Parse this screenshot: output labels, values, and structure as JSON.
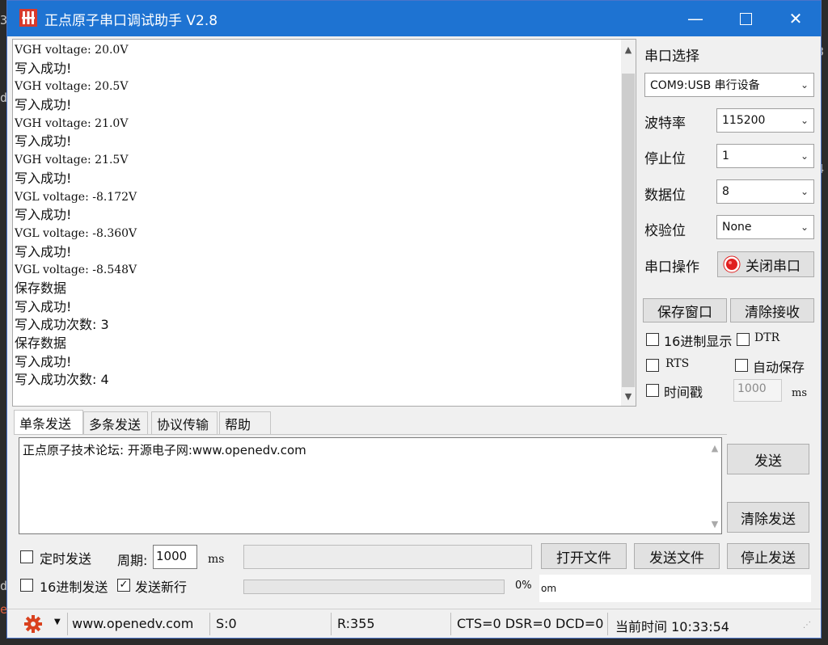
{
  "window": {
    "title": "正点原子串口调试助手 V2.8"
  },
  "background_fragments": [
    "3",
    "d",
    "3",
    "4",
    "d",
    "e"
  ],
  "receive": {
    "lines": [
      "VGH voltage: 20.0V",
      "写入成功!",
      "VGH voltage: 20.5V",
      "写入成功!",
      "VGH voltage: 21.0V",
      "写入成功!",
      "VGH voltage: 21.5V",
      "写入成功!",
      "VGL voltage: -8.172V",
      "写入成功!",
      "VGL voltage: -8.360V",
      "写入成功!",
      "VGL voltage: -8.548V",
      "保存数据",
      "写入成功!",
      "写入成功次数: 3",
      "保存数据",
      "写入成功!",
      "写入成功次数: 4"
    ]
  },
  "settings": {
    "port_label": "串口选择",
    "port_value": "COM9:USB 串行设备",
    "baud_label": "波特率",
    "baud_value": "115200",
    "stopbits_label": "停止位",
    "stopbits_value": "1",
    "databits_label": "数据位",
    "databits_value": "8",
    "parity_label": "校验位",
    "parity_value": "None",
    "operation_label": "串口操作",
    "close_port_label": "关闭串口",
    "save_window_label": "保存窗口",
    "clear_receive_label": "清除接收",
    "hex_display_label": "16进制显示",
    "dtr_label": "DTR",
    "rts_label": "RTS",
    "auto_save_label": "自动保存",
    "timestamp_label": "时间戳",
    "timestamp_value": "1000",
    "timestamp_unit": "ms"
  },
  "tabs": [
    {
      "label": "单条发送"
    },
    {
      "label": "多条发送"
    },
    {
      "label": "协议传输"
    },
    {
      "label": "帮助"
    }
  ],
  "send": {
    "text": "正点原子技术论坛: 开源电子网:www.openedv.com",
    "send_label": "发送",
    "clear_send_label": "清除发送",
    "timed_send_label": "定时发送",
    "period_label": "周期:",
    "period_value": "1000",
    "period_unit": "ms",
    "open_file_label": "打开文件",
    "send_file_label": "发送文件",
    "stop_send_label": "停止发送",
    "hex_send_label": "16进制发送",
    "newline_label": "发送新行",
    "progress_percent": "0%",
    "progress_value": 0,
    "log_fragment": "om"
  },
  "status": {
    "url": "www.openedv.com",
    "sent": "S:0",
    "received": "R:355",
    "lines": "CTS=0 DSR=0 DCD=0",
    "time": "当前时间 10:33:54"
  },
  "colors": {
    "titlebar": "#1e73d2",
    "close_port_indicator": "#e02020",
    "gear": "#d9411e"
  }
}
